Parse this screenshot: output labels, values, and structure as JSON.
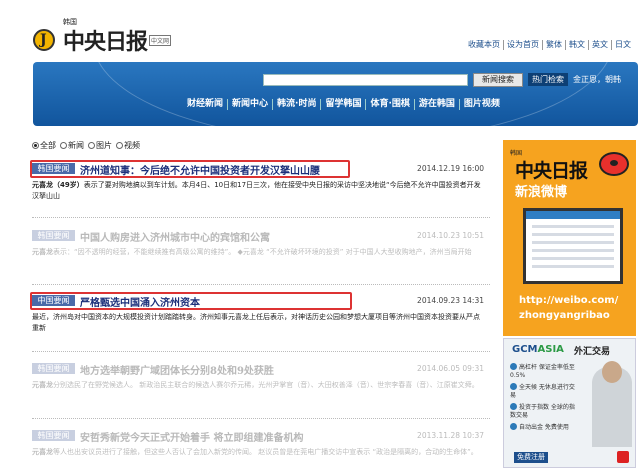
{
  "header": {
    "logo_small": "韩国",
    "logo_text": "中央日报",
    "logo_tag": "中文网",
    "top_links": [
      "收藏本页",
      "设为首页",
      "繁体",
      "韩文",
      "英文",
      "日文"
    ]
  },
  "banner": {
    "search_button": "新闻搜索",
    "hot_label": "热门检索",
    "hot_links": "金正恩，朝韩",
    "nav": [
      "财经新闻",
      "新闻中心",
      "韩流·时尚",
      "留学韩国",
      "体育·围棋",
      "游在韩国",
      "图片视频"
    ]
  },
  "filters": [
    {
      "label": "全部",
      "selected": true
    },
    {
      "label": "新闻",
      "selected": false
    },
    {
      "label": "图片",
      "selected": false
    },
    {
      "label": "视频",
      "selected": false
    }
  ],
  "news": [
    {
      "tag": "韩国要闻",
      "title": "济州道知事：今后绝不允许中国投资者开发汉拏山山腰",
      "date": "2014.12.19 16:00",
      "author": "元喜龙（49岁）",
      "body": "表示了要对购地搞以到车计划。本月4日、10日和17日三次，他在接受中央日报的采访中坚决地说“今后绝不允许中国投资者开发汉拏山山",
      "style": "active"
    },
    {
      "tag": "韩国要闻",
      "title": "中国人购房进入济州城市中心的宾馆和公寓",
      "date": "2014.10.23 10:51",
      "author": "元喜龙",
      "body": "表示：“因不透明的经营，不能继续推有高级公寓的维持”。 ◆元喜龙 “不允许破坏环境的投资” 对于中国人大型收购地产，济州当局开始",
      "style": "dim"
    },
    {
      "tag": "中国要闻",
      "title": "严格甄选中国涌入济州资本",
      "date": "2014.09.23 14:31",
      "author": "",
      "body": "最近，济州岛对中国资本的大规模投资计划踏踏转身。济州知事元喜龙上任后表示，对神话历史公园和梦想大厦项目等济州中国资本投资要从严点重新",
      "style": "active"
    },
    {
      "tag": "韩国要闻",
      "title": "地方选举朝野广域团体长分别8处和9处获胜",
      "date": "2014.06.05 09:31",
      "author": "元喜龙",
      "body": "分别选民了在野党候选人。 新政治民主联合的候选人赛尔乔元稀，光州尹掌官（音）、大田权善泽（音）、世宗李春喜（音）、江原崔文舜。",
      "style": "dim"
    },
    {
      "tag": "韩国要闻",
      "title": "安哲秀新党今天正式开始着手 将立即组建准备机构",
      "date": "2013.11.28 10:37",
      "author": "元喜龙",
      "body": "等人也出安议员进行了接触，但这些人否认了会加入新党的传闻。 赵议员曾是在莞电广播交访中宣表示 “政治是隔离的，合动的生命体”。",
      "style": "dim"
    }
  ],
  "weibo_ad": {
    "small": "韩国",
    "logo": "中央日报",
    "sub": "新浪微博",
    "url": "http://weibo.com/",
    "handle": "zhongyangribao"
  },
  "gcm_ad": {
    "brand_a": "GCM",
    "brand_b": "ASIA",
    "sub": "外汇交易",
    "items": [
      "高杠杆 保证金率低至0.5%",
      "全天候 无休息进行交易",
      "投资于指数 全球的指数交易",
      "自动出金 免费使用"
    ],
    "register": "免费注册"
  }
}
